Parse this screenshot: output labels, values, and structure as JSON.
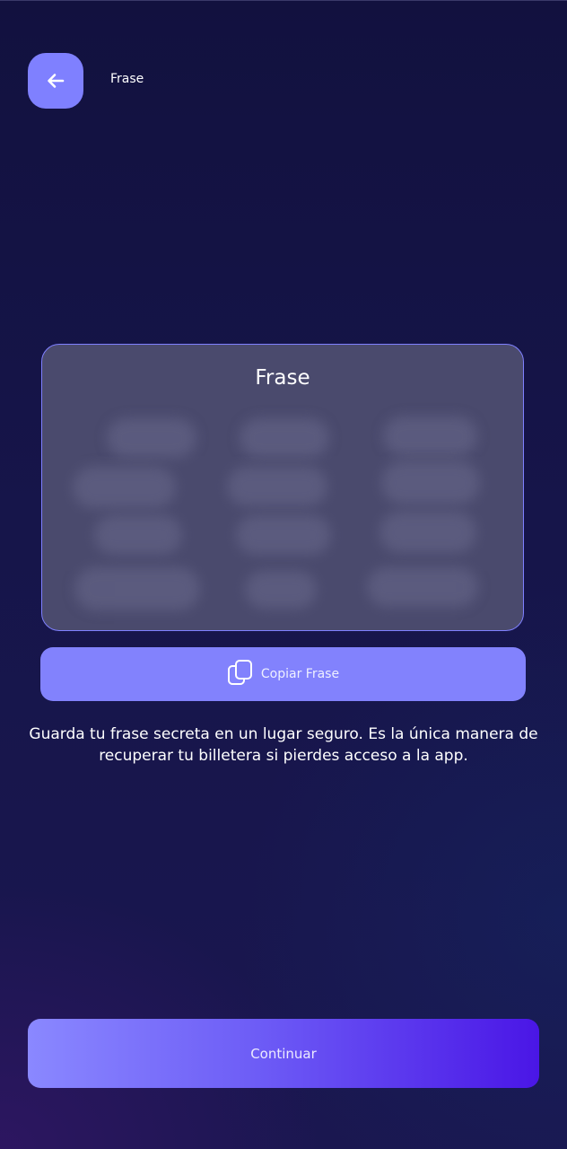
{
  "header": {
    "title": "Frase",
    "back_icon": "arrow-left-icon"
  },
  "card": {
    "title": "Frase",
    "words_hidden": true
  },
  "copy": {
    "label": "Copiar Frase",
    "icon": "copy-icon"
  },
  "info": {
    "text": "Guarda tu frase secreta en un lugar seguro. Es la única manera de recuperar tu billetera si pierdes acceso a la app."
  },
  "footer": {
    "continue_label": "Continuar"
  },
  "colors": {
    "accent": "#7f80ff",
    "background": "#12113f",
    "card": "#4a4a6d",
    "continue_start": "#8a88ff",
    "continue_end": "#4a16e6"
  }
}
